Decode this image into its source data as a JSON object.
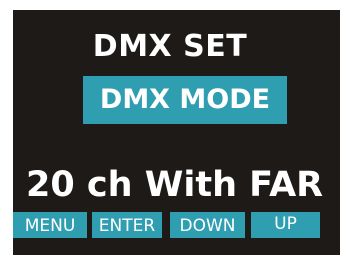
{
  "screen": {
    "title": "DMX SET",
    "selected_item": "DMX MODE",
    "value": "20 ch With FAR"
  },
  "softkeys": {
    "menu": "MENU",
    "enter": "ENTER",
    "down": "DOWN",
    "up": "UP"
  },
  "colors": {
    "background": "#1e1a17",
    "accent": "#2e9eb0",
    "text": "#ffffff"
  }
}
